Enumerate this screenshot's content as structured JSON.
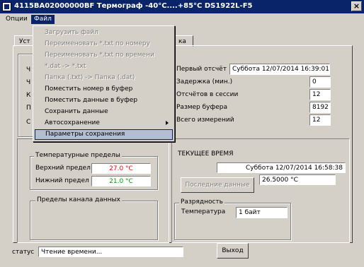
{
  "window": {
    "title": "4115BA02000000BF   Термограф -40°C....+85°C     DS1922L-F5",
    "close_label": "×"
  },
  "menu": {
    "items": [
      "Опции",
      "Файл"
    ]
  },
  "tabs": [
    "Уст",
    "ка"
  ],
  "left_labels": [
    "Ч",
    "Ч",
    "К",
    "П",
    "С"
  ],
  "info": {
    "first_reading_label": "Первый отсчёт",
    "first_reading_value": "Суббота 12/07/2014 16:39:01",
    "delay_label": "Задержка (мин.)",
    "delay_value": "0",
    "readings_label": "Отсчётов в сессии",
    "readings_value": "12",
    "buffer_label": "Размер буфера",
    "buffer_value": "8192",
    "total_label": "Всего измерений",
    "total_value": "12"
  },
  "temp_limits": {
    "title": "Температурные пределы",
    "upper_label": "Верхний предел",
    "upper_value": "27.0 °C",
    "lower_label": "Нижний предел",
    "lower_value": "21.0 °C",
    "upper_color": "#ff0000",
    "lower_color": "#00a000"
  },
  "channel_limits": {
    "title": "Пределы канала данных"
  },
  "current_time": {
    "title": "ТЕКУЩЕЕ ВРЕМЯ",
    "value": "Суббота 12/07/2014 16:58:38",
    "temp_value": "26.5000 °C",
    "last_data_label": "Последние данные"
  },
  "resolution": {
    "title": "Разрядность",
    "temp_label": "Температура",
    "temp_value": "1 байт"
  },
  "status": {
    "label": "статус",
    "value": "Чтение времени..."
  },
  "exit_label": "Выход",
  "file_menu": {
    "items": [
      {
        "label": "Загрузить файл",
        "disabled": true
      },
      {
        "label": "Переименовать *.txt по номеру",
        "disabled": true
      },
      {
        "label": "Переименовать *.txt по времени",
        "disabled": true
      },
      {
        "label": "*.dat -> *.txt",
        "disabled": true
      },
      {
        "label": "Папка (.txt) -> Папка (.dat)",
        "disabled": true
      },
      {
        "label": "Поместить номер в буфер",
        "disabled": false
      },
      {
        "label": "Поместить данные в буфер",
        "disabled": false
      },
      {
        "label": "Сохранить данные",
        "disabled": false
      },
      {
        "label": "Автосохранение",
        "disabled": false,
        "submenu": true
      },
      {
        "label": "Параметры сохранения",
        "disabled": false,
        "selected": true
      }
    ]
  }
}
